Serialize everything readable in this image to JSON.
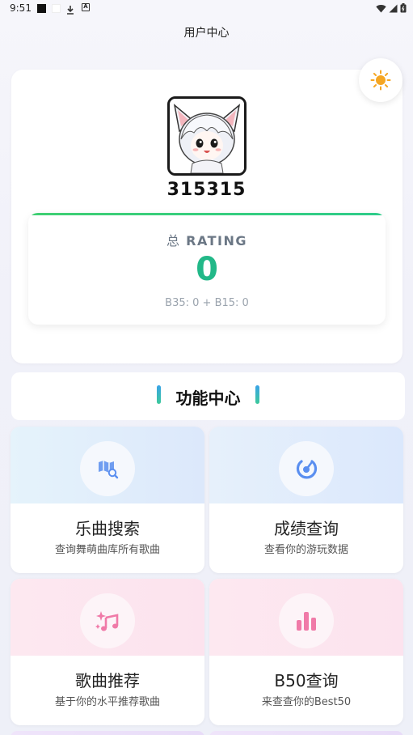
{
  "status_bar": {
    "time": "9:51"
  },
  "app": {
    "title": "用户中心"
  },
  "profile": {
    "username": "315315",
    "rating": {
      "label_prefix": "总",
      "label": "RATING",
      "value": "0",
      "detail": "B35: 0 + B15: 0"
    }
  },
  "section": {
    "title": "功能中心"
  },
  "features": [
    {
      "title": "乐曲搜索",
      "subtitle": "查询舞萌曲库所有歌曲",
      "icon": "map-search-icon"
    },
    {
      "title": "成绩查询",
      "subtitle": "查看你的游玩数据",
      "icon": "gauge-icon"
    },
    {
      "title": "歌曲推荐",
      "subtitle": "基于你的水平推荐歌曲",
      "icon": "sparkle-music-icon"
    },
    {
      "title": "B50查询",
      "subtitle": "来查查你的Best50",
      "icon": "bar-chart-icon"
    }
  ],
  "colors": {
    "rating_green": "#22b888",
    "accent_blue": "#5a8ff0",
    "accent_pink": "#f07aa8",
    "sun_orange": "#f5a623"
  }
}
